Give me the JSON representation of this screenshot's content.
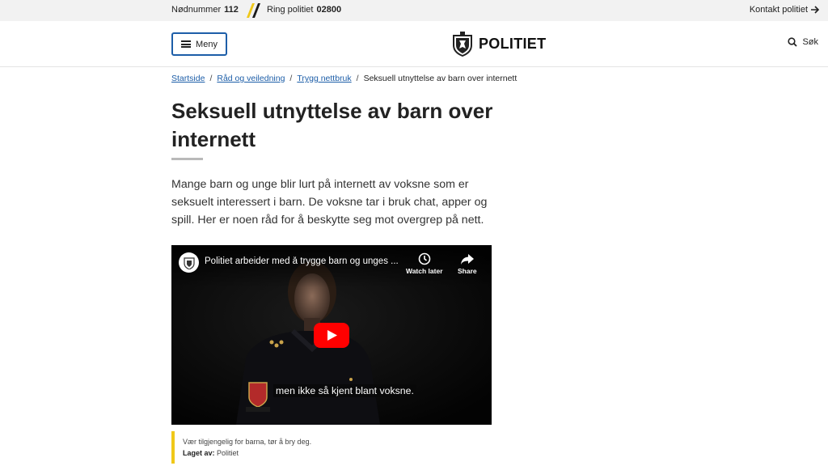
{
  "topbar": {
    "emergency_label": "Nødnummer",
    "emergency_number": "112",
    "ring_label": "Ring politiet",
    "ring_number": "02800",
    "contact": "Kontakt politiet"
  },
  "header": {
    "menu_label": "Meny",
    "logo_text": "POLITIET",
    "search_label": "Søk"
  },
  "breadcrumb": [
    {
      "label": "Startside"
    },
    {
      "label": "Råd og veiledning"
    },
    {
      "label": "Trygg nettbruk"
    },
    {
      "label": "Seksuell utnyttelse av barn over internett"
    }
  ],
  "article": {
    "title": "Seksuell utnyttelse av barn over internett",
    "lead": "Mange barn og unge blir lurt på internett av voksne som er seksuelt interessert i barn. De voksne tar i bruk chat, apper og spill. Her er noen råd for å beskytte seg mot overgrep på nett."
  },
  "video": {
    "title": "Politiet arbeider med å trygge barn og unges ...",
    "watch_later": "Watch later",
    "share": "Share",
    "subtitle": "men ikke så kjent blant voksne.",
    "caption": "Vær tilgjengelig for barna, tør å bry deg.",
    "made_by_label": "Laget av:",
    "made_by": "Politiet"
  },
  "colors": {
    "accent_blue": "#1d5ea8",
    "caption_bar": "#f0c819",
    "play_red": "#ff0000"
  }
}
